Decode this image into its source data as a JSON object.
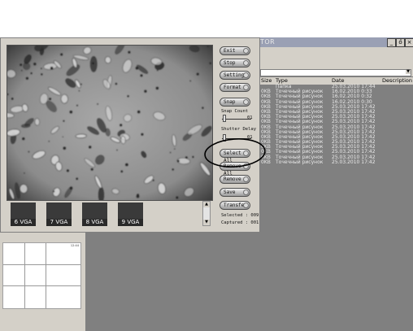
{
  "explorer": {
    "title_fragment": "TOR",
    "window_buttons": [
      "_",
      "ő",
      "×"
    ],
    "columns": [
      "Size",
      "Type",
      "Date",
      "Description"
    ],
    "files": [
      {
        "size": "",
        "type": "Папка",
        "date": "25.03.2010 17:44"
      },
      {
        "size": "0KB",
        "type": "Точечный рисунок",
        "date": "16.02.2010 0:33"
      },
      {
        "size": "0KB",
        "type": "Точечный рисунок",
        "date": "16.02.2010 0:32"
      },
      {
        "size": "0KB",
        "type": "Точечный рисунок",
        "date": "16.02.2010 0:30"
      },
      {
        "size": "0KB",
        "type": "Точечный рисунок",
        "date": "25.03.2010 17:42"
      },
      {
        "size": "0KB",
        "type": "Точечный рисунок",
        "date": "25.03.2010 17:42"
      },
      {
        "size": "0KB",
        "type": "Точечный рисунок",
        "date": "25.03.2010 17:42"
      },
      {
        "size": "0KB",
        "type": "Точечный рисунок",
        "date": "25.03.2010 17:42"
      },
      {
        "size": "0KB",
        "type": "Точечный рисунок",
        "date": "25.03.2010 17:42"
      },
      {
        "size": "0KB",
        "type": "Точечный рисунок",
        "date": "25.03.2010 17:42"
      },
      {
        "size": "0KB",
        "type": "Точечный рисунок",
        "date": "25.03.2010 17:42"
      },
      {
        "size": "0KB",
        "type": "Точечный рисунок",
        "date": "25.03.2010 17:42"
      },
      {
        "size": "0KB",
        "type": "Точечный рисунок",
        "date": "25.03.2010 17:42"
      },
      {
        "size": "0KB",
        "type": "Точечный рисунок",
        "date": "25.03.2010 17:42"
      },
      {
        "size": "0KB",
        "type": "Точечный рисунок",
        "date": "25.03.2010 17:42"
      },
      {
        "size": "0KB",
        "type": "Точечный рисунок",
        "date": "25.03.2010 17:42"
      }
    ]
  },
  "capture": {
    "buttons": {
      "exit": "Exit",
      "stop": "Stop",
      "setting": "Setting",
      "format": "Format",
      "snap": "Snap",
      "select_all": "Select All",
      "remove_all": "Remove All",
      "remove": "Remove",
      "save": "Save",
      "transfer": "Transfer"
    },
    "snap_count_label": "Snap Count",
    "snap_count_value": "01",
    "shutter_delay_label": "Shutter Delay",
    "shutter_delay_value": "01",
    "selected_label": "Selected : 009",
    "captured_label": "Captured : 001",
    "thumbnails": [
      "6 VGA",
      "7 VGA",
      "8 VGA",
      "9 VGA"
    ],
    "scroll_up": "▲",
    "scroll_down": "▼"
  },
  "preview_grid": {
    "timestamp": "12:44"
  },
  "colors": {
    "dialog_bg": "#d4d0c8",
    "explorer_bg": "#808080",
    "annotation": "#000000"
  }
}
